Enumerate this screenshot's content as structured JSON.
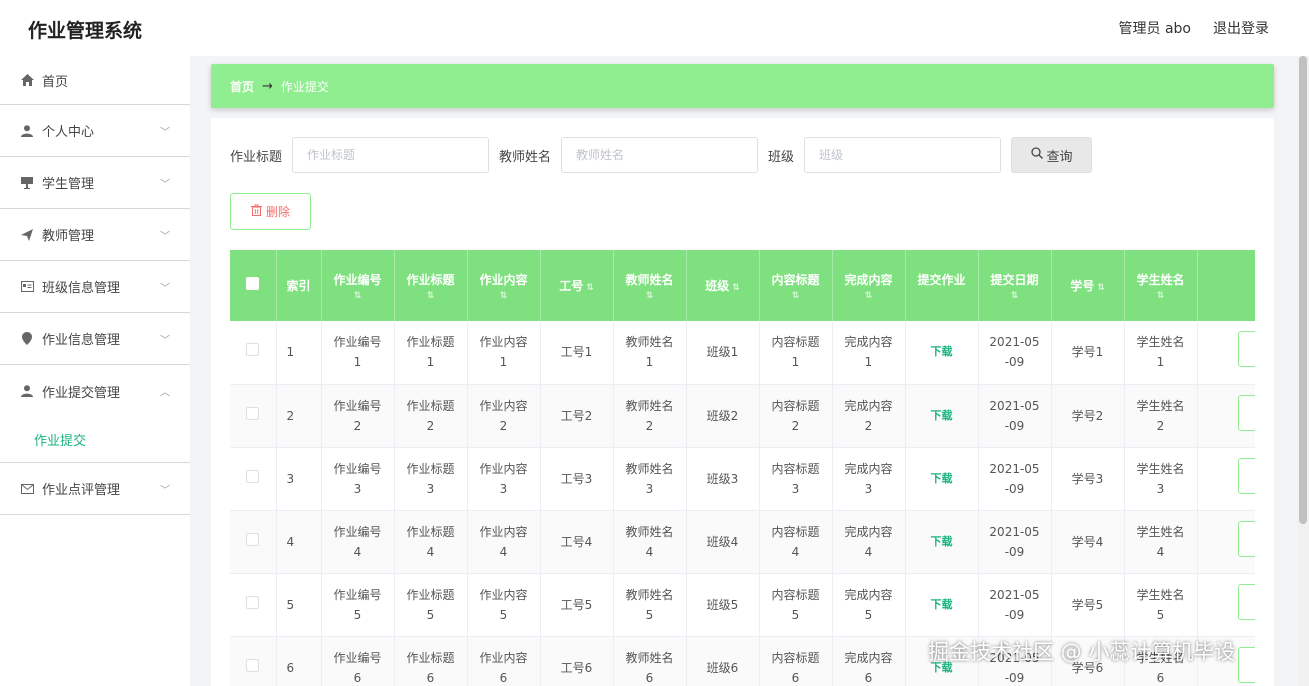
{
  "app": {
    "title": "作业管理系统"
  },
  "user": {
    "role_label": "管理员 abo",
    "logout_label": "退出登录"
  },
  "sidebar": {
    "items": [
      {
        "label": "首页",
        "icon": "home-icon"
      },
      {
        "label": "个人中心",
        "icon": "user-icon"
      },
      {
        "label": "学生管理",
        "icon": "board-icon"
      },
      {
        "label": "教师管理",
        "icon": "send-icon"
      },
      {
        "label": "班级信息管理",
        "icon": "id-card-icon"
      },
      {
        "label": "作业信息管理",
        "icon": "location-icon"
      },
      {
        "label": "作业提交管理",
        "icon": "user-icon"
      },
      {
        "label": "作业点评管理",
        "icon": "mail-icon"
      }
    ],
    "active_sub": "作业提交"
  },
  "breadcrumb": {
    "home": "首页",
    "current": "作业提交"
  },
  "search": {
    "title_label": "作业标题",
    "title_placeholder": "作业标题",
    "teacher_label": "教师姓名",
    "teacher_placeholder": "教师姓名",
    "class_label": "班级",
    "class_placeholder": "班级",
    "query_label": "查询"
  },
  "actions": {
    "delete_label": "删除"
  },
  "table": {
    "columns": [
      "索引",
      "作业编号",
      "作业标题",
      "作业内容",
      "工号",
      "教师姓名",
      "班级",
      "内容标题",
      "完成内容",
      "提交作业",
      "提交日期",
      "学号",
      "学生姓名"
    ],
    "rows": [
      {
        "index": "1",
        "hw_no": "作业编号\n1",
        "hw_title": "作业标题\n1",
        "hw_content": "作业内容\n1",
        "staff_no": "工号1",
        "teacher": "教师姓名\n1",
        "class": "班级1",
        "content_title": "内容标题\n1",
        "done_content": "完成内容\n1",
        "download": "下载",
        "date": "2021-05\n-09",
        "student_no": "学号1",
        "student": "学生姓名\n1"
      },
      {
        "index": "2",
        "hw_no": "作业编号\n2",
        "hw_title": "作业标题\n2",
        "hw_content": "作业内容\n2",
        "staff_no": "工号2",
        "teacher": "教师姓名\n2",
        "class": "班级2",
        "content_title": "内容标题\n2",
        "done_content": "完成内容\n2",
        "download": "下载",
        "date": "2021-05\n-09",
        "student_no": "学号2",
        "student": "学生姓名\n2"
      },
      {
        "index": "3",
        "hw_no": "作业编号\n3",
        "hw_title": "作业标题\n3",
        "hw_content": "作业内容\n3",
        "staff_no": "工号3",
        "teacher": "教师姓名\n3",
        "class": "班级3",
        "content_title": "内容标题\n3",
        "done_content": "完成内容\n3",
        "download": "下载",
        "date": "2021-05\n-09",
        "student_no": "学号3",
        "student": "学生姓名\n3"
      },
      {
        "index": "4",
        "hw_no": "作业编号\n4",
        "hw_title": "作业标题\n4",
        "hw_content": "作业内容\n4",
        "staff_no": "工号4",
        "teacher": "教师姓名\n4",
        "class": "班级4",
        "content_title": "内容标题\n4",
        "done_content": "完成内容\n4",
        "download": "下载",
        "date": "2021-05\n-09",
        "student_no": "学号4",
        "student": "学生姓名\n4"
      },
      {
        "index": "5",
        "hw_no": "作业编号\n5",
        "hw_title": "作业标题\n5",
        "hw_content": "作业内容\n5",
        "staff_no": "工号5",
        "teacher": "教师姓名\n5",
        "class": "班级5",
        "content_title": "内容标题\n5",
        "done_content": "完成内容\n5",
        "download": "下载",
        "date": "2021-05\n-09",
        "student_no": "学号5",
        "student": "学生姓名\n5"
      },
      {
        "index": "6",
        "hw_no": "作业编号\n6",
        "hw_title": "作业标题\n6",
        "hw_content": "作业内容\n6",
        "staff_no": "工号6",
        "teacher": "教师姓名\n6",
        "class": "班级6",
        "content_title": "内容标题\n6",
        "done_content": "完成内容\n6",
        "download": "下载",
        "date": "2021-05\n-09",
        "student_no": "学号6",
        "student": "学生姓名\n6"
      }
    ]
  },
  "watermark": "掘金技术社区 @ 小蕊计算机毕设",
  "colors": {
    "accent_green": "#90ee90",
    "header_green": "#7fe07f",
    "link_green": "#19b37f",
    "danger": "#f56c6c"
  }
}
